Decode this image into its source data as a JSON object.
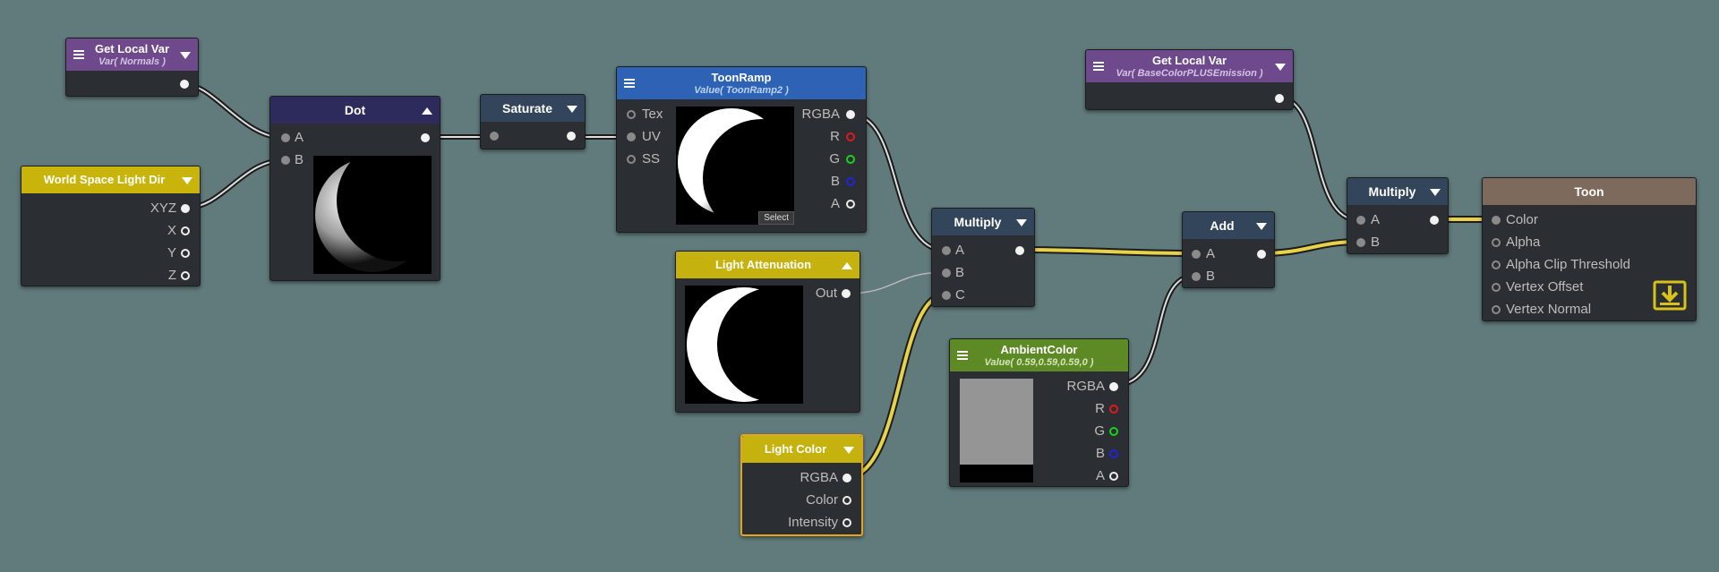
{
  "nodes": {
    "get_local_var_normals": {
      "title": "Get Local Var",
      "subtitle": "Var( Normals )"
    },
    "world_space_light_dir": {
      "title": "World Space Light Dir",
      "ports": [
        "XYZ",
        "X",
        "Y",
        "Z"
      ]
    },
    "dot": {
      "title": "Dot",
      "inputs": [
        "A",
        "B"
      ]
    },
    "saturate": {
      "title": "Saturate"
    },
    "toon_ramp": {
      "title": "ToonRamp",
      "subtitle": "Value( ToonRamp2 )",
      "inputs": [
        "Tex",
        "UV",
        "SS"
      ],
      "outputs": [
        "RGBA",
        "R",
        "G",
        "B",
        "A"
      ],
      "select_label": "Select"
    },
    "light_attenuation": {
      "title": "Light Attenuation",
      "output": "Out"
    },
    "light_color": {
      "title": "Light Color",
      "outputs": [
        "RGBA",
        "Color",
        "Intensity"
      ]
    },
    "multiply_1": {
      "title": "Multiply",
      "inputs": [
        "A",
        "B",
        "C"
      ]
    },
    "ambient_color": {
      "title": "AmbientColor",
      "subtitle": "Value( 0.59,0.59,0.59,0 )",
      "outputs": [
        "RGBA",
        "R",
        "G",
        "B",
        "A"
      ],
      "swatch_color": "#959595"
    },
    "get_local_var_basecolor": {
      "title": "Get Local Var",
      "subtitle": "Var( BaseColorPLUSEmission )"
    },
    "add": {
      "title": "Add",
      "inputs": [
        "A",
        "B"
      ]
    },
    "multiply_2": {
      "title": "Multiply",
      "inputs": [
        "A",
        "B"
      ]
    },
    "toon": {
      "title": "Toon",
      "inputs": [
        "Color",
        "Alpha",
        "Alpha Clip Threshold",
        "Vertex Offset",
        "Vertex Normal"
      ]
    }
  },
  "colors": {
    "canvas": "#617a7b",
    "node_body": "#2b2e32",
    "header_local_var": "#6e4a8c",
    "header_world_light": "#c9b40c",
    "header_math": "#33455a",
    "header_dot": "#2c2b5c",
    "header_texture": "#2d62b4",
    "header_light": "#c6b20e",
    "header_ambient": "#5d8a25",
    "header_toon": "#7d6a5c",
    "wire_color": "#e8d24a",
    "selection": "#e5a41a"
  },
  "icons": {
    "menu": "menu-icon",
    "collapse": "triangle-down-icon",
    "expand": "triangle-up-icon",
    "save": "save-download-icon"
  }
}
